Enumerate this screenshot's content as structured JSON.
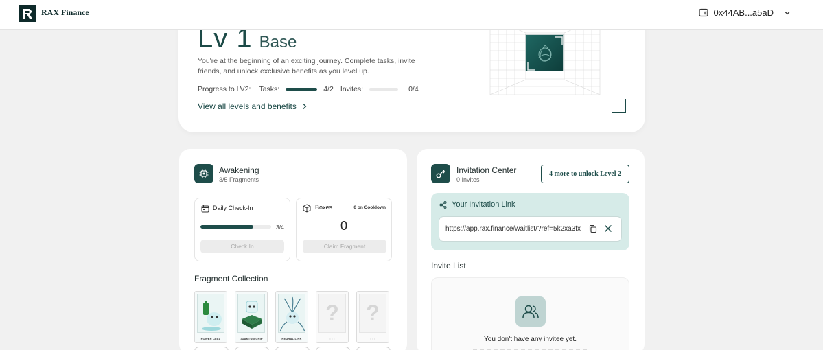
{
  "header": {
    "brand": "RAX Finance",
    "wallet_address": "0x44AB...a5aD",
    "wallet_icon": "wallet-icon",
    "dropdown_icon": "chevron-down-icon"
  },
  "level": {
    "number": "Lv 1",
    "name": "Base",
    "description": "You're at the beginning of an exciting journey. Complete tasks, invite friends, and unlock exclusive benefits as you level up.",
    "progress_label": "Progress to LV2:",
    "tasks_label": "Tasks:",
    "tasks_value": "4/2",
    "tasks_progress": 1.0,
    "invites_label": "Invites:",
    "invites_value": "0/4",
    "invites_progress": 0.0,
    "view_link": "View all levels and benefits"
  },
  "awakening": {
    "title": "Awakening",
    "subtitle": "3/5 Fragments",
    "daily": {
      "title": "Daily Check-In",
      "value": "3/4",
      "progress": 0.75,
      "button": "Check In"
    },
    "boxes": {
      "title": "Boxes",
      "cooldown": "0 on Cooldown",
      "count": "0",
      "button": "Claim Fragment"
    },
    "collection_title": "Fragment Collection",
    "fragments": [
      {
        "label": "POWER CELL",
        "locked": false
      },
      {
        "label": "QUANTUM CHIP",
        "locked": false
      },
      {
        "label": "NEURAL LINK",
        "locked": false
      },
      {
        "label": "?",
        "locked": true
      },
      {
        "label": "?",
        "locked": true
      }
    ]
  },
  "invitation": {
    "title": "Invitation Center",
    "subtitle": "0 Invites",
    "unlock_button": "4 more to unlock Level 2",
    "link_title": "Your Invitation Link",
    "link_url": "https://app.rax.finance/waitlist/?ref=5k2xa3fx",
    "list_title": "Invite List",
    "empty_text": "You don't have any invitee yet."
  },
  "colors": {
    "accent": "#1e4d4a",
    "panel": "#d6ebe8",
    "background": "#f1f1f1"
  }
}
